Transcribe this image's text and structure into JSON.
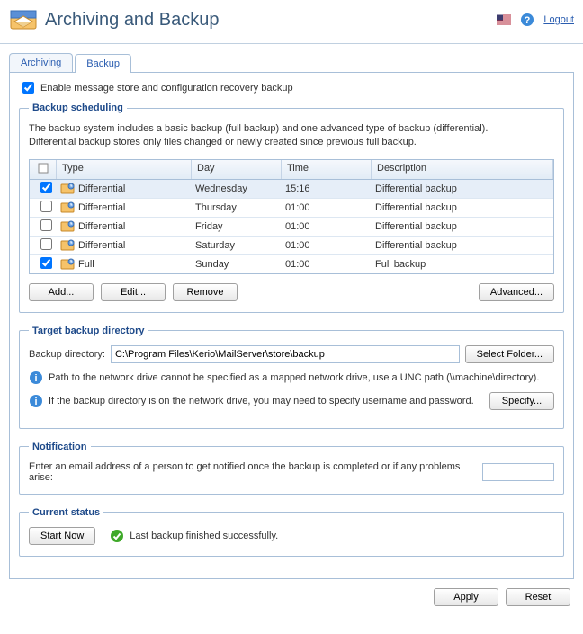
{
  "header": {
    "title": "Archiving and Backup",
    "logout": "Logout"
  },
  "tabs": {
    "archiving": "Archiving",
    "backup": "Backup"
  },
  "main": {
    "enable_label": "Enable message store and configuration recovery backup"
  },
  "scheduling": {
    "legend": "Backup scheduling",
    "desc1": "The backup system includes a basic backup (full backup) and one advanced type of backup (differential).",
    "desc2": "Differential backup stores only files changed or newly created since previous full backup.",
    "cols": {
      "type": "Type",
      "day": "Day",
      "time": "Time",
      "desc": "Description"
    },
    "rows": [
      {
        "checked": true,
        "type": "Differential",
        "day": "Wednesday",
        "time": "15:16",
        "desc": "Differential backup",
        "selected": true
      },
      {
        "checked": false,
        "type": "Differential",
        "day": "Thursday",
        "time": "01:00",
        "desc": "Differential backup",
        "selected": false
      },
      {
        "checked": false,
        "type": "Differential",
        "day": "Friday",
        "time": "01:00",
        "desc": "Differential backup",
        "selected": false
      },
      {
        "checked": false,
        "type": "Differential",
        "day": "Saturday",
        "time": "01:00",
        "desc": "Differential backup",
        "selected": false
      },
      {
        "checked": true,
        "type": "Full",
        "day": "Sunday",
        "time": "01:00",
        "desc": "Full backup",
        "selected": false
      }
    ],
    "buttons": {
      "add": "Add...",
      "edit": "Edit...",
      "remove": "Remove",
      "advanced": "Advanced..."
    }
  },
  "target": {
    "legend": "Target backup directory",
    "label": "Backup directory:",
    "path": "C:\\Program Files\\Kerio\\MailServer\\store\\backup",
    "select": "Select Folder...",
    "info1": "Path to the network drive cannot be specified as a mapped network drive, use a UNC path (\\\\machine\\directory).",
    "info2": "If the backup directory is on the network drive, you may need to specify username and password.",
    "specify": "Specify..."
  },
  "notification": {
    "legend": "Notification",
    "label": "Enter an email address of a person to get notified once the backup is completed or if any problems arise:",
    "value": ""
  },
  "status": {
    "legend": "Current status",
    "start": "Start Now",
    "text": "Last backup finished successfully."
  },
  "footer": {
    "apply": "Apply",
    "reset": "Reset"
  }
}
